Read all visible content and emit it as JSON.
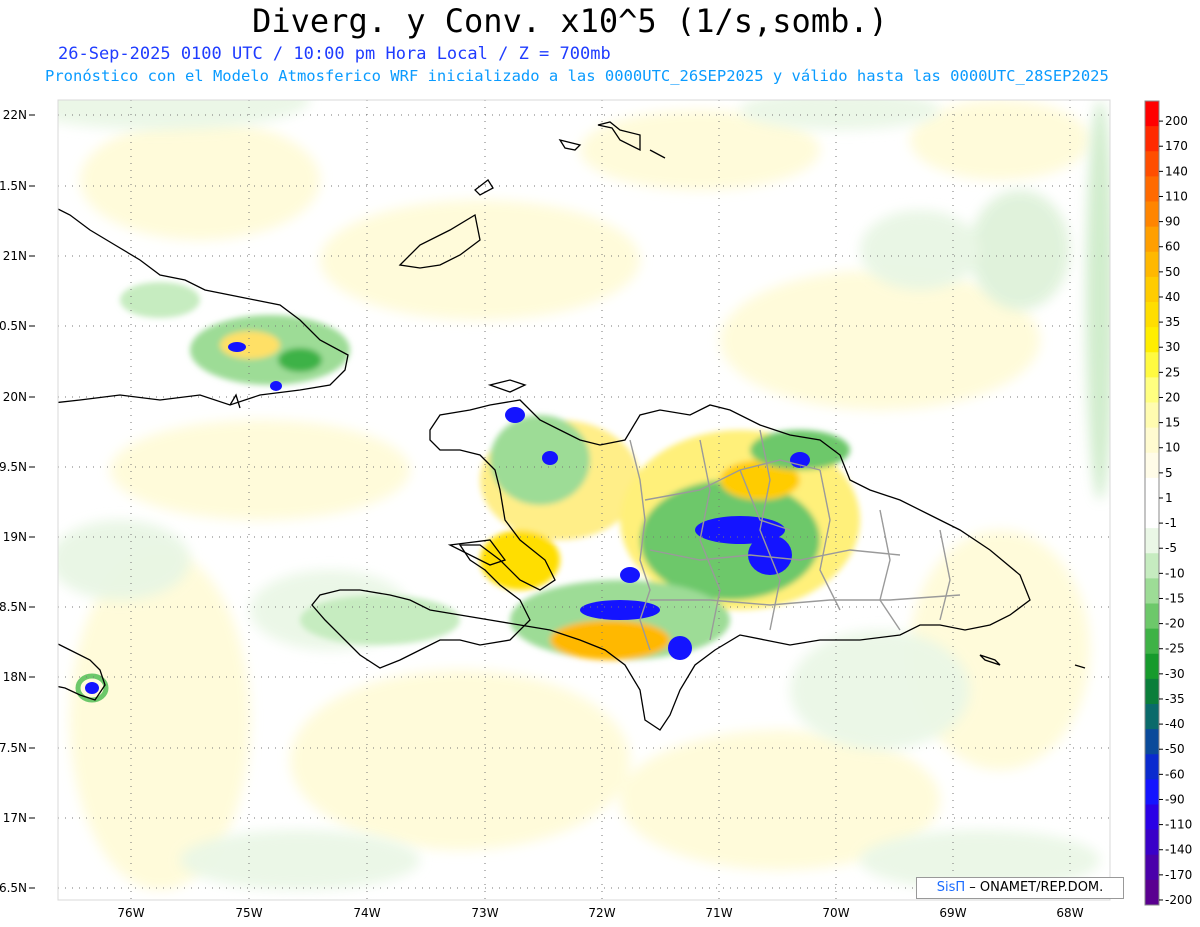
{
  "header": {
    "title": "Diverg. y Conv. x10^5 (1/s,somb.)",
    "subtitle_time": "26-Sep-2025 0100 UTC / 10:00 pm Hora Local / Z = 700mb",
    "subtitle_model": "Pronóstico con el Modelo Atmosferico WRF inicializado a las 0000UTC_26SEP2025 y válido hasta las  0000UTC_28SEP2025"
  },
  "map": {
    "lon_labels": [
      "76W",
      "75W",
      "74W",
      "73W",
      "72W",
      "71W",
      "70W",
      "69W",
      "68W"
    ],
    "lat_labels": [
      "22N",
      "1.5N",
      "21N",
      "0.5N",
      "20N",
      "9.5N",
      "19N",
      "8.5N",
      "18N",
      "7.5N",
      "17N",
      "6.5N"
    ],
    "credit_brand": "SisΠ",
    "credit_text": " – ONAMET/REP.DOM."
  },
  "colorbar": {
    "labels": [
      "200",
      "170",
      "140",
      "110",
      "90",
      "60",
      "50",
      "40",
      "35",
      "30",
      "25",
      "20",
      "15",
      "10",
      "5",
      "1",
      "-1",
      "-5",
      "-10",
      "-15",
      "-20",
      "-25",
      "-30",
      "-35",
      "-40",
      "-50",
      "-60",
      "-90",
      "-110",
      "-140",
      "-170",
      "-200"
    ],
    "colors": [
      "#ff0000",
      "#ff2a00",
      "#ff4e00",
      "#ff6a00",
      "#ff8500",
      "#ff9f00",
      "#ffb800",
      "#ffcc00",
      "#ffde00",
      "#ffee00",
      "#fffa40",
      "#ffff80",
      "#fffcb0",
      "#fffbd0",
      "#fffce8",
      "#ffffff",
      "#ffffff",
      "#eaf7e6",
      "#c6ecc0",
      "#9ddc96",
      "#6dc86a",
      "#3eb246",
      "#169a2c",
      "#0a7e3a",
      "#0a6a6a",
      "#0a4a9a",
      "#0a2acf",
      "#1414ff",
      "#2a00e6",
      "#3a00c8",
      "#4a00aa",
      "#5a0090"
    ]
  }
}
